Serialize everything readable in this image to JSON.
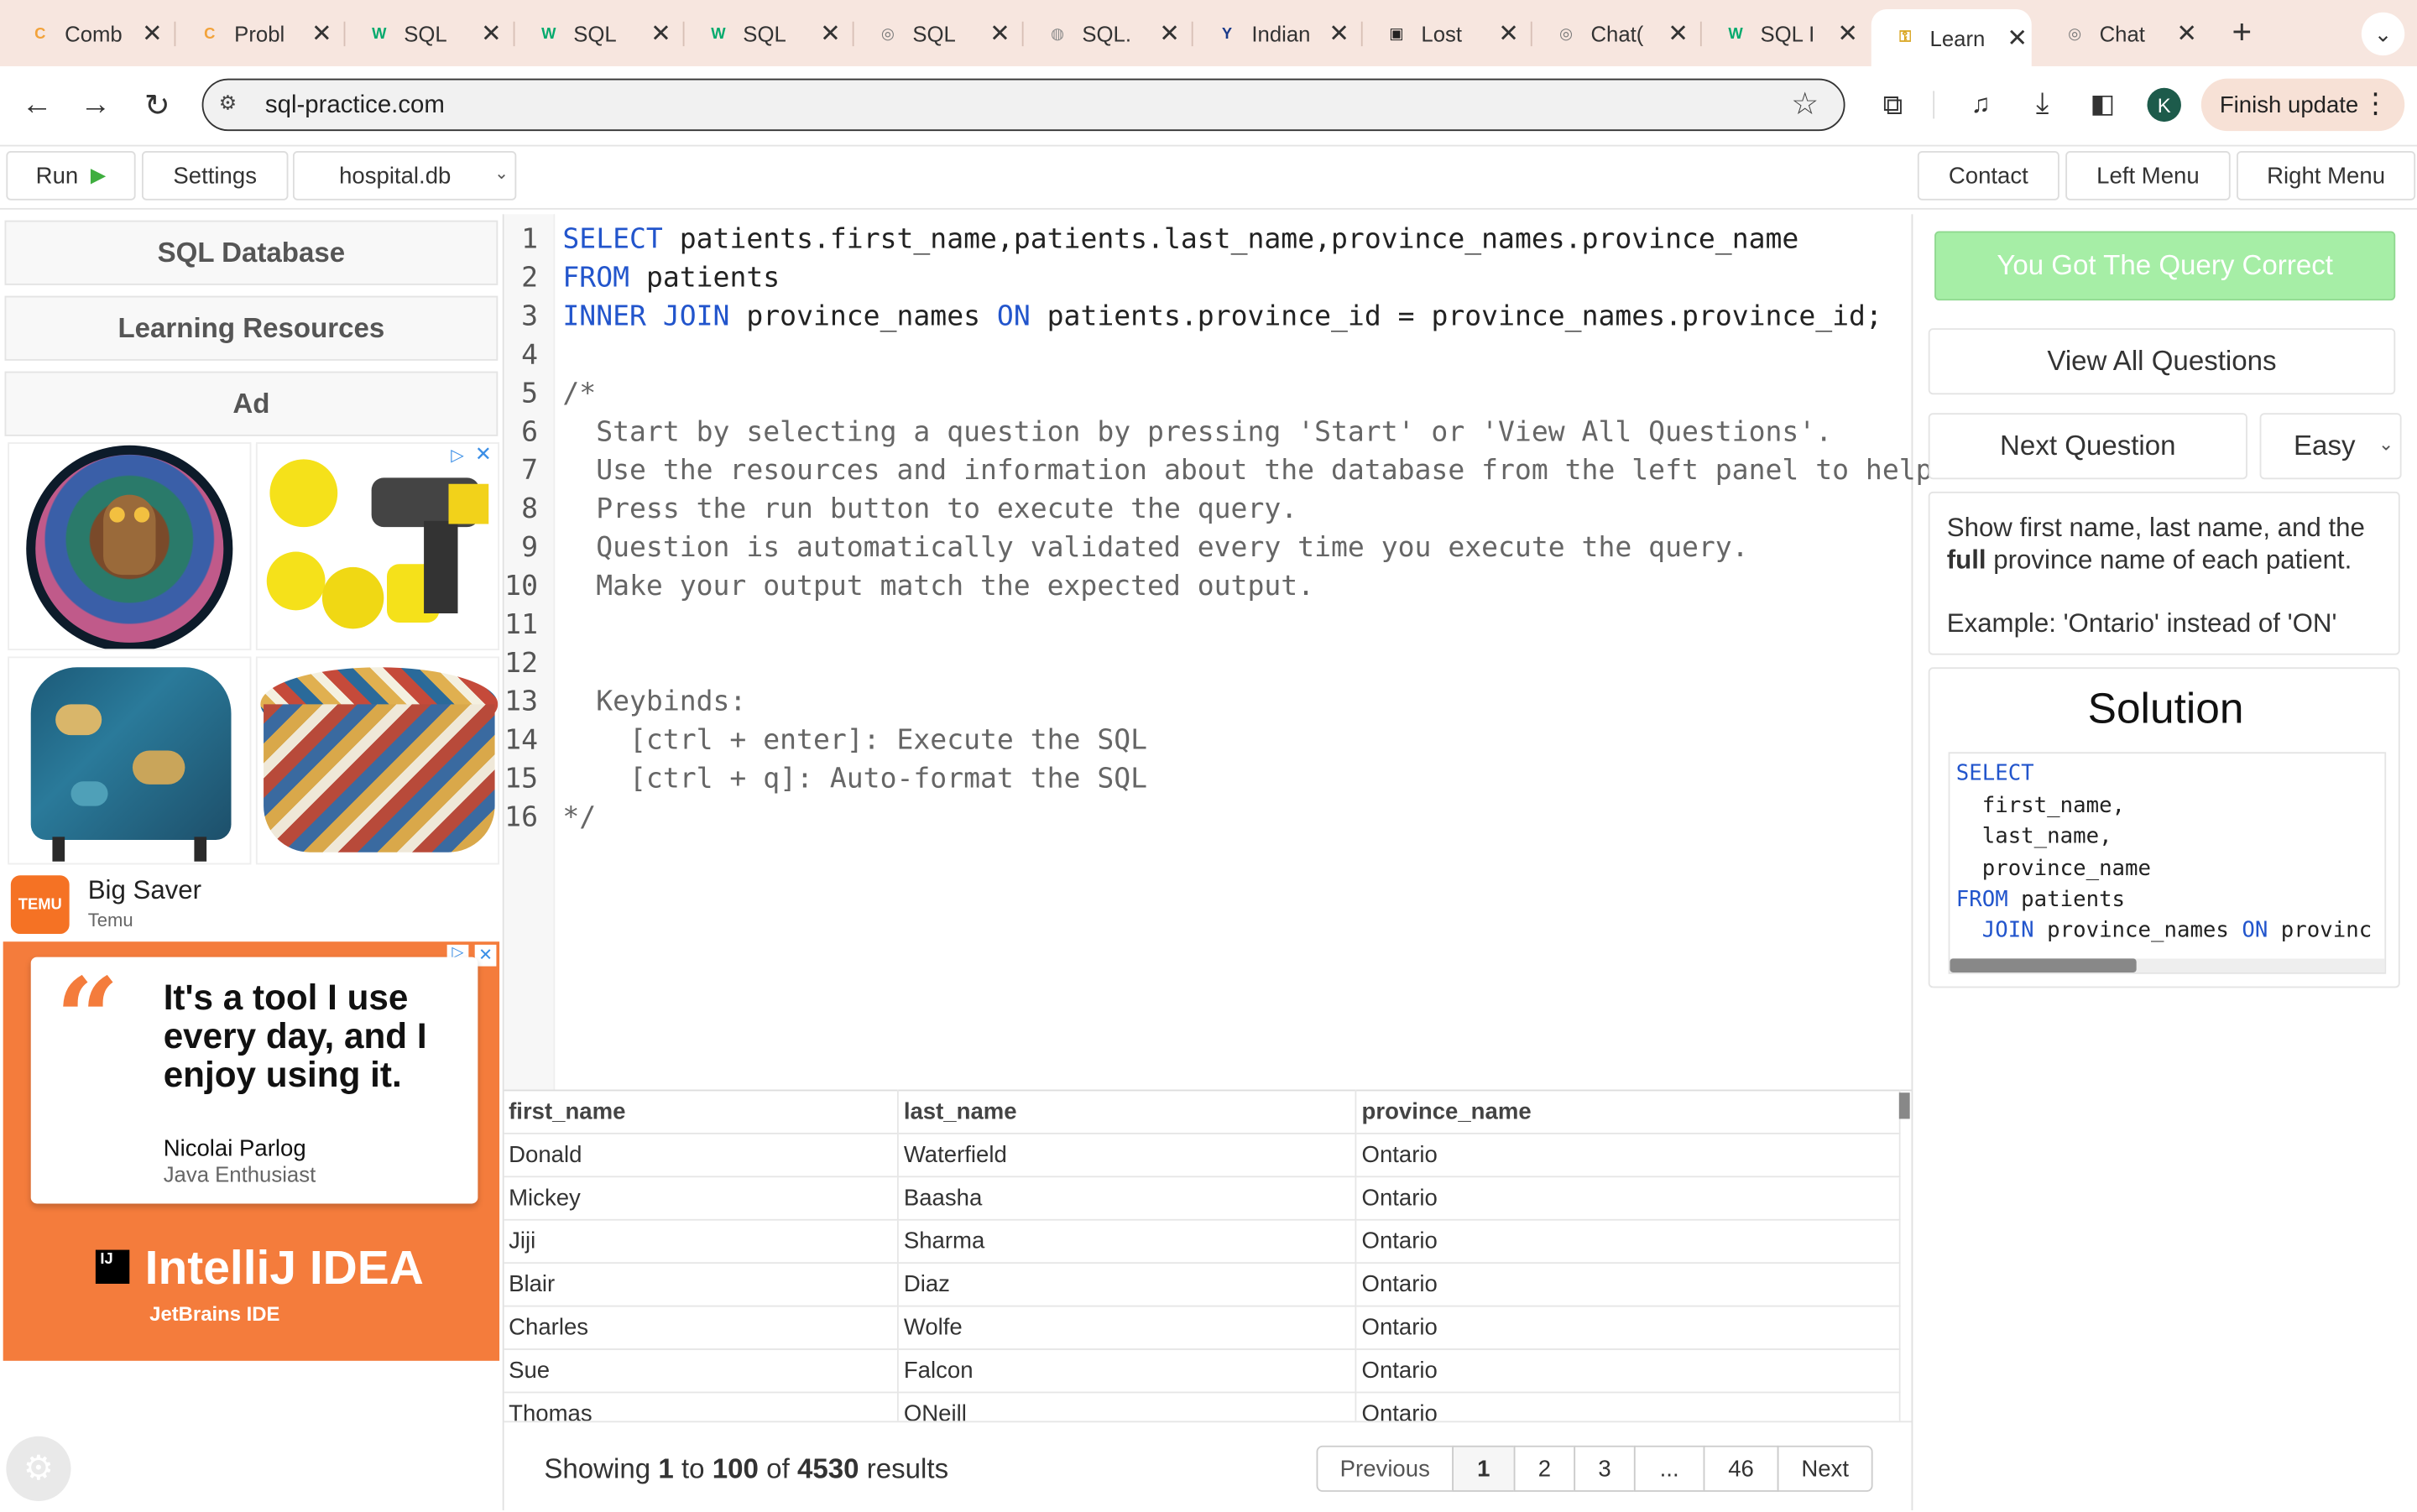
{
  "browser": {
    "tabs": [
      {
        "title": "Comb",
        "icon": "c-logo-icon"
      },
      {
        "title": "Probl",
        "icon": "c-logo-icon"
      },
      {
        "title": "SQL",
        "icon": "w3-icon"
      },
      {
        "title": "SQL",
        "icon": "w3-icon"
      },
      {
        "title": "SQL",
        "icon": "w3-icon"
      },
      {
        "title": "SQL",
        "icon": "openai-icon"
      },
      {
        "title": "SQL.",
        "icon": "globe-icon"
      },
      {
        "title": "Indian",
        "icon": "brand-icon"
      },
      {
        "title": "Lost",
        "icon": "image-icon"
      },
      {
        "title": "Chat(",
        "icon": "openai-icon"
      },
      {
        "title": "SQL I",
        "icon": "w3-icon"
      },
      {
        "title": "Learn",
        "icon": "key-icon"
      },
      {
        "title": "Chat",
        "icon": "openai-icon"
      }
    ],
    "new_tab": "+",
    "url": "sql-practice.com",
    "profile_initial": "K",
    "finish_update": "Finish update"
  },
  "app_toolbar": {
    "run": "Run",
    "settings": "Settings",
    "database": "hospital.db",
    "contact": "Contact",
    "left_menu": "Left Menu",
    "right_menu": "Right Menu"
  },
  "left_panel": {
    "sql_database": "SQL Database",
    "learning_resources": "Learning Resources",
    "ad_header": "Ad",
    "temu_title": "Big Saver",
    "temu_subtitle": "Temu",
    "temu_logo": "TEMU",
    "banner_quote": "It's a tool I use every day, and I enjoy using it.",
    "banner_author": "Nicolai Parlog",
    "banner_role": "Java Enthusiast",
    "banner_product": "IntelliJ IDEA",
    "banner_company": "JetBrains IDE"
  },
  "editor": {
    "line_numbers": [
      "1",
      "2",
      "3",
      "4",
      "5",
      "6",
      "7",
      "8",
      "9",
      "10",
      "11",
      "12",
      "13",
      "14",
      "15",
      "16"
    ],
    "line1_kw": "SELECT",
    "line1_rest": " patients.first_name,patients.last_name,province_names.province_name",
    "line2_kw": "FROM",
    "line2_rest": " patients",
    "line3_kw1": "INNER JOIN",
    "line3_mid": " province_names ",
    "line3_kw2": "ON",
    "line3_rest": " patients.province_id = province_names.province_id;",
    "comment_lines": [
      "/*",
      "  Start by selecting a question by pressing 'Start' or 'View All Questions'.",
      "  Use the resources and information about the database from the left panel to help.",
      "  Press the run button to execute the query.",
      "  Question is automatically validated every time you execute the query.",
      "  Make your output match the expected output.",
      "",
      "",
      "  Keybinds:",
      "    [ctrl + enter]: Execute the SQL",
      "    [ctrl + q]: Auto-format the SQL",
      "*/"
    ]
  },
  "results": {
    "columns": [
      "first_name",
      "last_name",
      "province_name"
    ],
    "rows": [
      [
        "Donald",
        "Waterfield",
        "Ontario"
      ],
      [
        "Mickey",
        "Baasha",
        "Ontario"
      ],
      [
        "Jiji",
        "Sharma",
        "Ontario"
      ],
      [
        "Blair",
        "Diaz",
        "Ontario"
      ],
      [
        "Charles",
        "Wolfe",
        "Ontario"
      ],
      [
        "Sue",
        "Falcon",
        "Ontario"
      ],
      [
        "Thomas",
        "ONeill",
        "Ontario"
      ]
    ],
    "showing_prefix": "Showing",
    "showing_from": "1",
    "showing_to_word": "to",
    "showing_to": "100",
    "showing_of_word": "of",
    "showing_total": "4530",
    "showing_suffix": "results",
    "pagination": {
      "previous": "Previous",
      "pages": [
        "1",
        "2",
        "3",
        "...",
        "46"
      ],
      "next": "Next",
      "current": "1"
    }
  },
  "right_panel": {
    "correct": "You Got The Query Correct",
    "view_all": "View All Questions",
    "next_question": "Next Question",
    "difficulty": "Easy",
    "question_pre": "Show first name, last name, and the",
    "question_bold": "full",
    "question_post": "province name of each patient.",
    "question_example": "Example: 'Ontario' instead of 'ON'",
    "solution_title": "Solution",
    "solution_lines": [
      {
        "kw": "SELECT",
        "text": ""
      },
      {
        "kw": "",
        "text": "  first_name,"
      },
      {
        "kw": "",
        "text": "  last_name,"
      },
      {
        "kw": "",
        "text": "  province_name"
      },
      {
        "kw": "FROM",
        "text": " patients"
      }
    ],
    "solution_join_kw": "JOIN",
    "solution_join_mid": " province_names ",
    "solution_join_kw2": "ON",
    "solution_join_rest": " provinc"
  },
  "colors": {
    "tabstrip": "#f7e6df",
    "keyword": "#2255cc",
    "correct_bg": "#a6eea6",
    "ad_orange": "#f47c3c"
  }
}
